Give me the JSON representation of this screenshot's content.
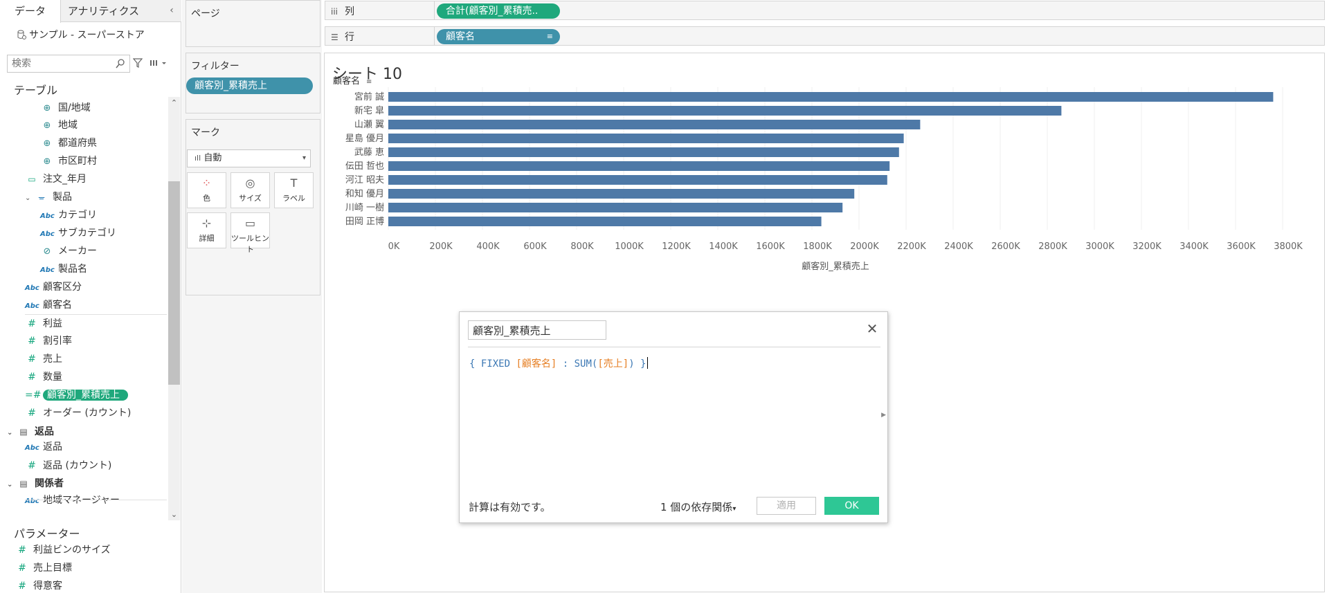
{
  "left_pane": {
    "tab_data": "データ",
    "tab_analytics": "アナリティクス",
    "collapse_glyph": "‹",
    "datasource": "サンプル - スーパーストア",
    "search_placeholder": "検索",
    "tables_heading": "テーブル",
    "fields": [
      {
        "label": "国/地域",
        "icon": "globe-icon",
        "glyph": "⊕"
      },
      {
        "label": "地域",
        "icon": "globe-icon",
        "glyph": "⊕"
      },
      {
        "label": "都道府県",
        "icon": "globe-icon",
        "glyph": "⊕"
      },
      {
        "label": "市区町村",
        "icon": "globe-icon",
        "glyph": "⊕"
      },
      {
        "label": "注文_年月",
        "icon": "date-icon",
        "glyph": "▭"
      },
      {
        "label": "製品",
        "icon": "hierarchy-icon",
        "glyph": "ᚚ"
      },
      {
        "label": "カテゴリ",
        "icon": "string-icon",
        "glyph": "Abc"
      },
      {
        "label": "サブカテゴリ",
        "icon": "string-icon",
        "glyph": "Abc"
      },
      {
        "label": "メーカー",
        "icon": "group-icon",
        "glyph": "⊘"
      },
      {
        "label": "製品名",
        "icon": "string-icon",
        "glyph": "Abc"
      },
      {
        "label": "顧客区分",
        "icon": "string-icon",
        "glyph": "Abc"
      },
      {
        "label": "顧客名",
        "icon": "string-icon",
        "glyph": "Abc"
      },
      {
        "label": "利益",
        "icon": "number-icon",
        "glyph": "#"
      },
      {
        "label": "割引率",
        "icon": "number-icon",
        "glyph": "#"
      },
      {
        "label": "売上",
        "icon": "number-icon",
        "glyph": "#"
      },
      {
        "label": "数量",
        "icon": "number-icon",
        "glyph": "#"
      },
      {
        "label": "顧客別_累積売上",
        "icon": "calc-number-icon",
        "glyph": "=#"
      },
      {
        "label": "オーダー (カウント)",
        "icon": "number-icon",
        "glyph": "#"
      },
      {
        "label": "返品",
        "icon": "table-icon",
        "glyph": "▤"
      },
      {
        "label": "返品",
        "icon": "string-icon",
        "glyph": "Abc"
      },
      {
        "label": "返品 (カウント)",
        "icon": "number-icon",
        "glyph": "#"
      },
      {
        "label": "関係者",
        "icon": "table-icon",
        "glyph": "▤"
      },
      {
        "label": "地域マネージャー",
        "icon": "string-icon",
        "glyph": "Abc"
      }
    ],
    "params_heading": "パラメーター",
    "params": [
      {
        "label": "利益ビンのサイズ",
        "glyph": "#"
      },
      {
        "label": "売上目標",
        "glyph": "#"
      },
      {
        "label": "得意客",
        "glyph": "#"
      }
    ]
  },
  "cards": {
    "pages": "ページ",
    "filters": "フィルター",
    "filter_pill": "顧客別_累積売上",
    "marks": "マーク",
    "marks_type": "自動",
    "mark_buttons": [
      {
        "label": "色",
        "icon": "color-icon"
      },
      {
        "label": "サイズ",
        "icon": "size-icon"
      },
      {
        "label": "ラベル",
        "icon": "label-icon"
      },
      {
        "label": "詳細",
        "icon": "detail-icon"
      },
      {
        "label": "ツールヒント",
        "icon": "tooltip-icon"
      }
    ]
  },
  "shelves": {
    "columns_label": "列",
    "columns_pill": "合計(顧客別_累積売..",
    "rows_label": "行",
    "rows_pill": "顧客名"
  },
  "sheet": {
    "title": "シート 10"
  },
  "colors": {
    "bar": "#4e79a7",
    "green_pill": "#1fa87c",
    "blue_pill": "#3f92aa",
    "ok_button": "#2ec795"
  },
  "chart_data": {
    "type": "bar",
    "orientation": "horizontal",
    "row_header": "顧客名",
    "categories": [
      "宮前 誠",
      "新宅 皐",
      "山瀬 翼",
      "星島 優月",
      "武藤 恵",
      "伝田 哲也",
      "河江 昭夫",
      "和知 優月",
      "川崎 一樹",
      "田岡 正博"
    ],
    "values": [
      3760000,
      2860000,
      2260000,
      2190000,
      2170000,
      2130000,
      2120000,
      1980000,
      1930000,
      1840000
    ],
    "xlabel": "顧客別_累積売上",
    "xlim": [
      0,
      3950000
    ],
    "xticks": [
      0,
      200000,
      400000,
      600000,
      800000,
      1000000,
      1200000,
      1400000,
      1600000,
      1800000,
      2000000,
      2200000,
      2400000,
      2600000,
      2800000,
      3000000,
      3200000,
      3400000,
      3600000,
      3800000
    ],
    "xtick_labels": [
      "0K",
      "200K",
      "400K",
      "600K",
      "800K",
      "1000K",
      "1200K",
      "1400K",
      "1600K",
      "1800K",
      "2000K",
      "2200K",
      "2400K",
      "2600K",
      "2800K",
      "3000K",
      "3200K",
      "3400K",
      "3600K",
      "3800K"
    ],
    "grid": true
  },
  "calc_dialog": {
    "name": "顧客別_累積売上",
    "formula_parts": {
      "open": "{ ",
      "kw_fixed": "FIXED",
      "field1": "[顧客名]",
      "colon": " : ",
      "kw_sum": "SUM(",
      "field2": "[売上]",
      "close_paren": ")",
      "close": " }"
    },
    "status": "計算は有効です。",
    "dependencies": "1 個の依存関係",
    "apply": "適用",
    "ok": "OK"
  }
}
